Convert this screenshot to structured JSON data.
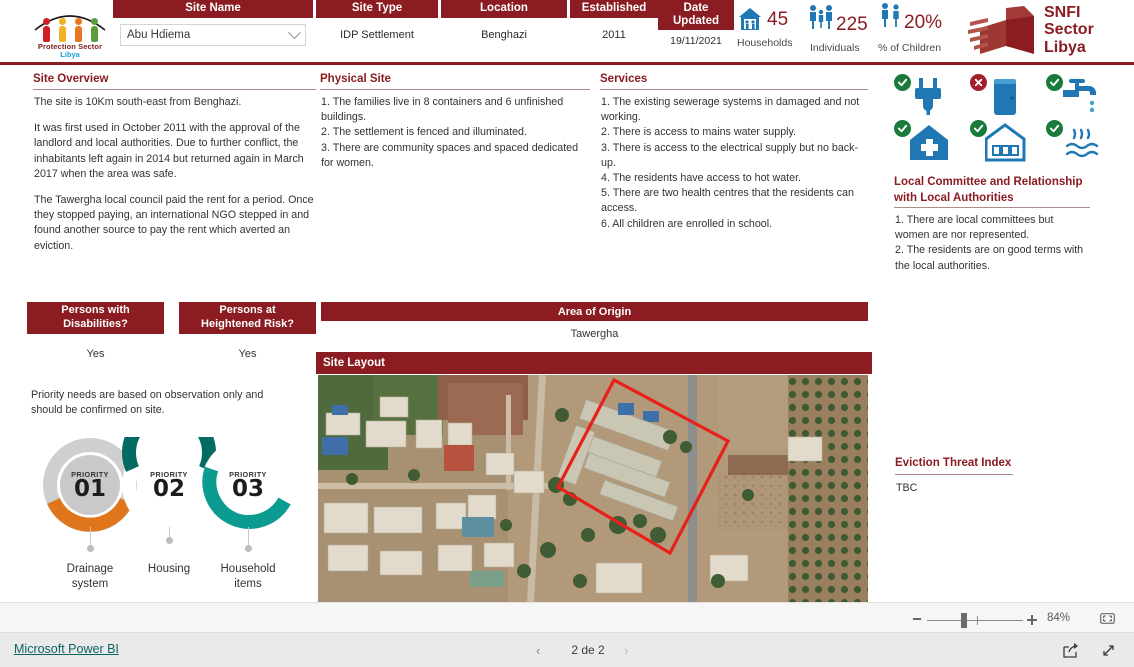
{
  "brand": {
    "logo_line1": "Protection Sector",
    "logo_line2": "Libya",
    "snfi_title": "SNFI\nSector\nLibya",
    "snfi_l1": "SNFI",
    "snfi_l2": "Sector",
    "snfi_l3": "Libya",
    "maroon": "#8a1c22",
    "blue": "#1f78b4",
    "green": "#1a7a3c",
    "red": "#a31f2a"
  },
  "header": {
    "fields": [
      {
        "label": "Site Name",
        "value": "Abu Hdiema",
        "control": "dropdown"
      },
      {
        "label": "Site Type",
        "value": "IDP Settlement",
        "control": "text"
      },
      {
        "label": "Location",
        "value": "Benghazi",
        "control": "text"
      },
      {
        "label": "Established",
        "value": "2011",
        "control": "text"
      },
      {
        "label": "Date\nUpdated",
        "label_l1": "Date",
        "label_l2": "Updated",
        "value": "19/11/2021",
        "control": "text"
      }
    ],
    "stats": [
      {
        "icon": "household-icon",
        "value": "45",
        "label": "Households"
      },
      {
        "icon": "family-icon",
        "value": "225",
        "label": "Individuals"
      },
      {
        "icon": "children-icon",
        "value": "20%",
        "label": "% of Children"
      }
    ]
  },
  "panels": {
    "site_overview": {
      "title": "Site Overview",
      "paragraphs": [
        "The site is 10Km south-east from Benghazi.",
        "It was first used in October 2011 with the approval of the landlord and local authorities. Due to further conflict, the inhabitants left again in 2014 but returned again in March 2017 when the area was safe.",
        "The Tawergha local council paid the rent for a period. Once they stopped paying, an international NGO stepped in and found another source to pay the rent which averted an eviction."
      ]
    },
    "physical_site": {
      "title": "Physical Site",
      "items": [
        "1. The families live in 8 containers and 6 unfinished buildings.",
        "2. The settlement is fenced and illuminated.",
        "3. There are community spaces and spaced dedicated for women."
      ]
    },
    "services": {
      "title": "Services",
      "items": [
        "1. The existing sewerage systems in damaged and not working.",
        "2. There is access to mains water supply.",
        "3. There is access to the electrical supply but no back-up.",
        "4. The residents have access to hot water.",
        "5. There are two health centres that the residents can access.",
        "6. All children are enrolled in school."
      ]
    },
    "local_committee": {
      "title_l1": "Local Committee and Relationship",
      "title_l2": "with Local Authorities",
      "items": [
        "1. There are local committees but women are nor represented.",
        "2. The residents are on good terms with the local authorities."
      ]
    },
    "eviction": {
      "title": "Eviction Threat Index",
      "value": "TBC"
    }
  },
  "service_icons": [
    {
      "name": "electricity-plug-icon",
      "status": "available"
    },
    {
      "name": "latrine-icon",
      "status": "unavailable"
    },
    {
      "name": "water-tap-icon",
      "status": "available"
    },
    {
      "name": "health-clinic-icon",
      "status": "available"
    },
    {
      "name": "school-icon",
      "status": "available"
    },
    {
      "name": "hot-water-icon",
      "status": "available"
    }
  ],
  "questions": [
    {
      "label_l1": "Persons with",
      "label_l2": "Disabilities?",
      "answer": "Yes"
    },
    {
      "label_l1": "Persons at",
      "label_l2": "Heightened Risk?",
      "answer": "Yes"
    }
  ],
  "area_of_origin": {
    "title": "Area of Origin",
    "value": "Tawergha"
  },
  "site_layout": {
    "title": "Site Layout"
  },
  "priority_note": "Priority needs are based on observation only and should be confirmed on site.",
  "priorities": [
    {
      "rank_label": "PRIORITY",
      "rank": "01",
      "caption_l1": "Drainage",
      "caption_l2": "system",
      "color": "#e0761b"
    },
    {
      "rank_label": "PRIORITY",
      "rank": "02",
      "caption_l1": "Housing",
      "caption_l2": "",
      "color": "#036b63"
    },
    {
      "rank_label": "PRIORITY",
      "rank": "03",
      "caption_l1": "Household",
      "caption_l2": "items",
      "color": "#0c9b90"
    }
  ],
  "zoom_bar": {
    "minus": "−",
    "plus": "+",
    "percent": "84%",
    "fit_icon": "fit-to-page-icon"
  },
  "footer": {
    "brand_link": "Microsoft Power BI",
    "prev_icon": "chevron-left-icon",
    "page_text": "2 de 2",
    "next_icon": "chevron-right-icon",
    "share_icon": "share-icon",
    "fullscreen_icon": "fullscreen-icon"
  }
}
